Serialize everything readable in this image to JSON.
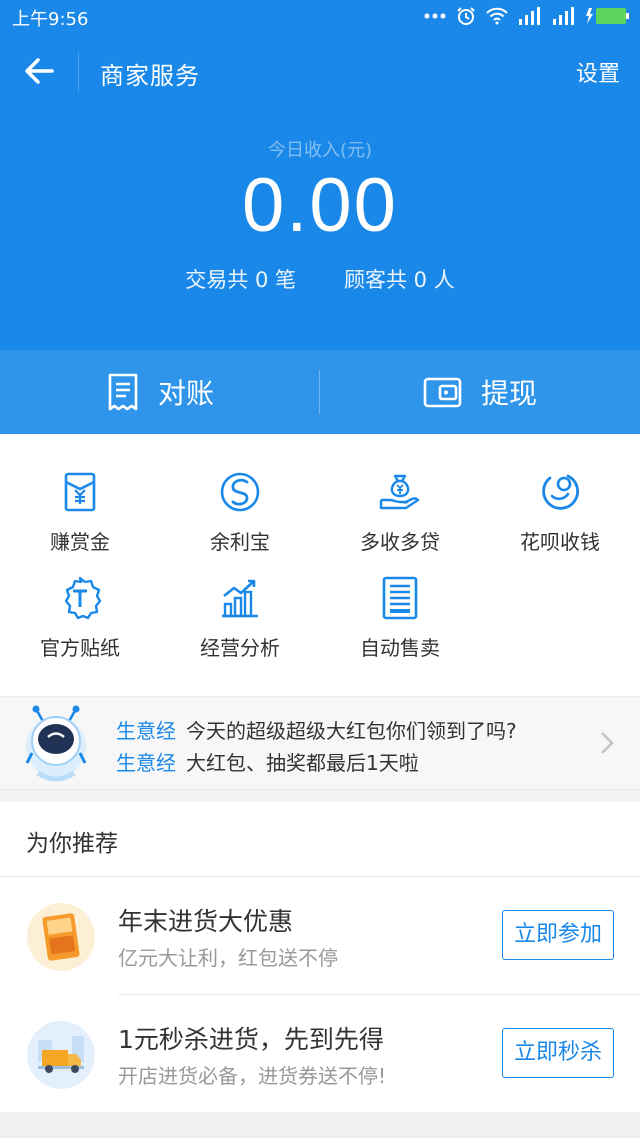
{
  "status_bar": {
    "time": "上午9:56",
    "battery_color": "#5dd55d"
  },
  "header": {
    "title": "商家服务",
    "settings_label": "设置",
    "income_label": "今日收入(元)",
    "income_amount": "0.00",
    "transactions_label": "交易共 0 笔",
    "customers_label": "顾客共 0 人"
  },
  "actions": [
    {
      "label": "对账",
      "icon": "receipt-icon"
    },
    {
      "label": "提现",
      "icon": "wallet-icon"
    }
  ],
  "services": [
    {
      "label": "赚赏金",
      "icon": "reward-envelope-icon"
    },
    {
      "label": "余利宝",
      "icon": "yulibao-icon"
    },
    {
      "label": "多收多贷",
      "icon": "money-bag-hand-icon"
    },
    {
      "label": "花呗收钱",
      "icon": "huabei-icon"
    },
    {
      "label": "官方贴纸",
      "icon": "sticker-badge-icon"
    },
    {
      "label": "经营分析",
      "icon": "bar-chart-icon"
    },
    {
      "label": "自动售卖",
      "icon": "vending-machine-icon"
    }
  ],
  "news": {
    "items": [
      {
        "tag": "生意经",
        "text": "今天的超级超级大红包你们领到了吗?"
      },
      {
        "tag": "生意经",
        "text": "大红包、抽奖都最后1天啦"
      }
    ]
  },
  "recommend": {
    "title": "为你推荐",
    "items": [
      {
        "title": "年末进货大优惠",
        "subtitle": "亿元大让利，红包送不停",
        "button": "立即参加",
        "icon": "shopping-festival-icon"
      },
      {
        "title": "1元秒杀进货，先到先得",
        "subtitle": "开店进货必备，进货券送不停!",
        "button": "立即秒杀",
        "icon": "delivery-truck-icon"
      }
    ]
  },
  "colors": {
    "primary": "#1a88e8",
    "action_bar": "#2f95ea",
    "icon_blue": "#1a88e8"
  }
}
